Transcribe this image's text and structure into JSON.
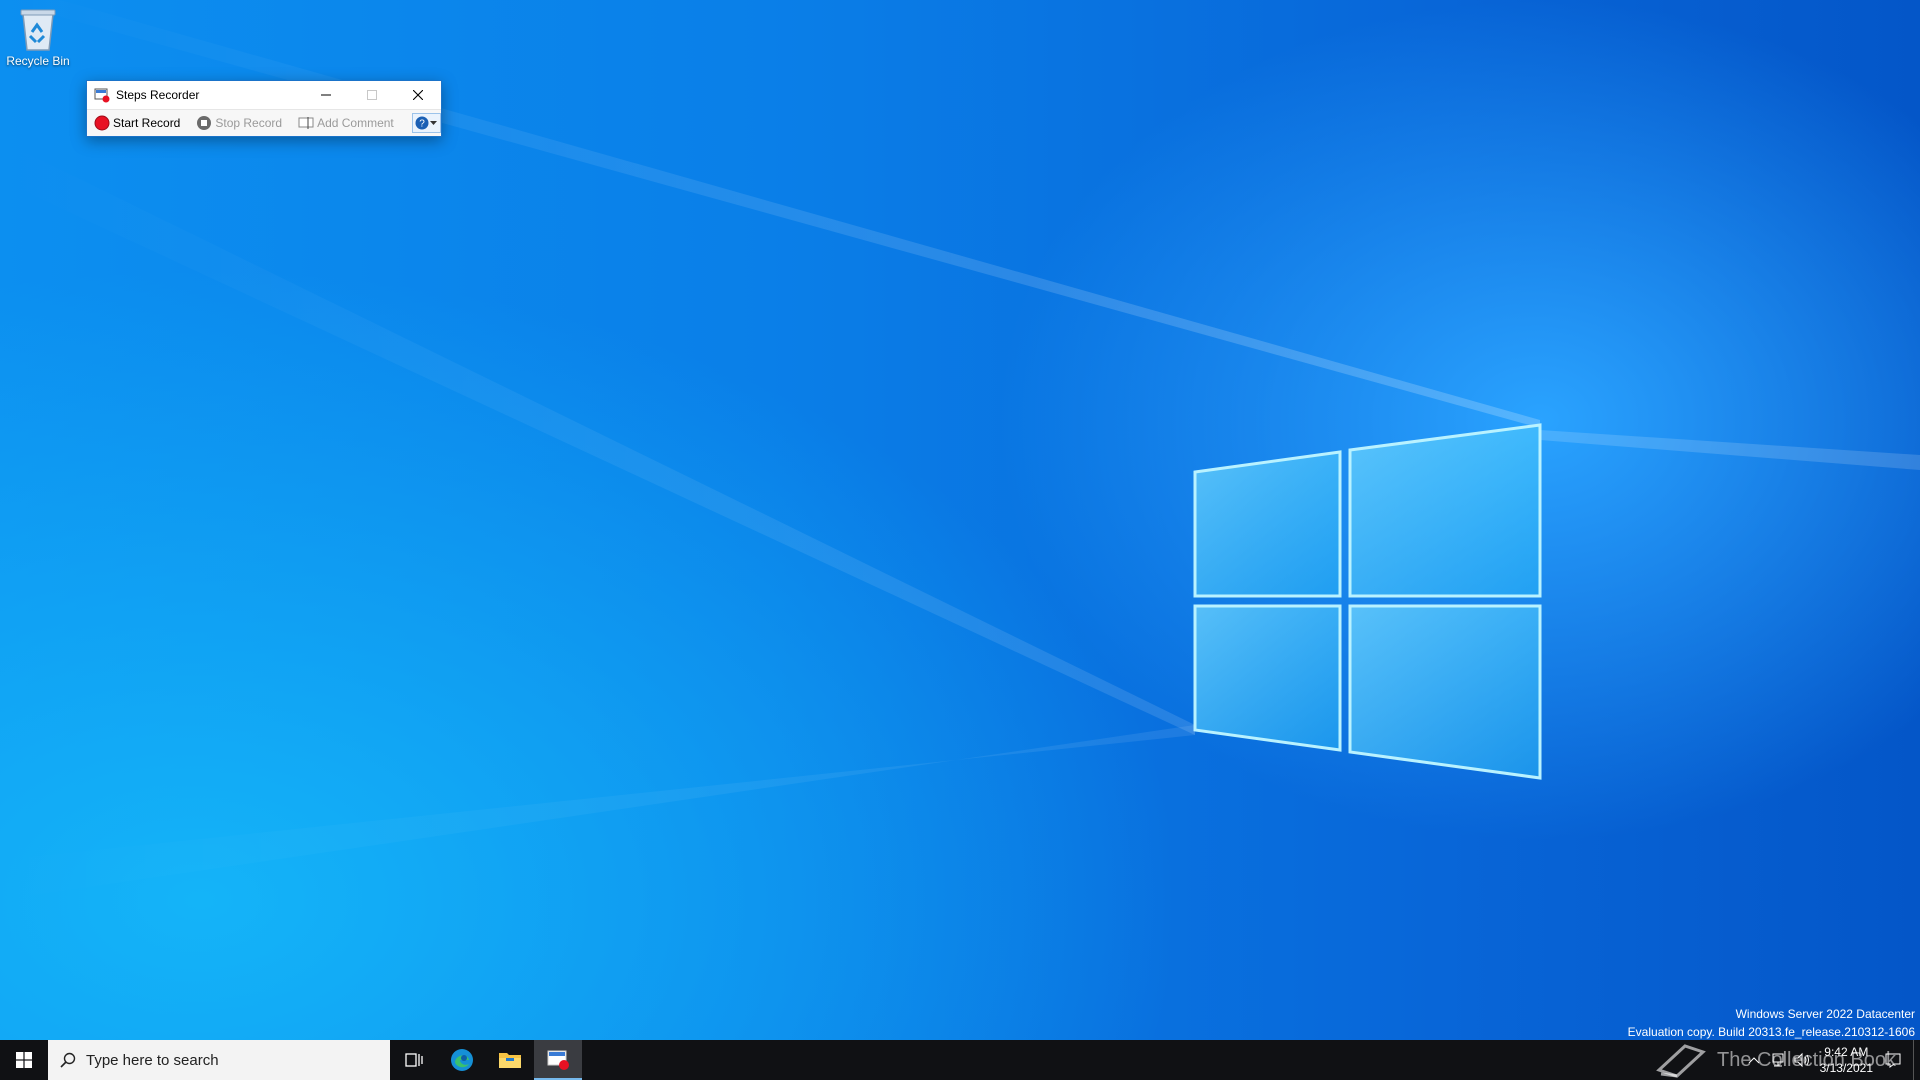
{
  "desktop": {
    "icons": [
      {
        "label": "Recycle Bin",
        "icon": "recycle-bin-icon"
      }
    ]
  },
  "window": {
    "title": "Steps Recorder",
    "controls": {
      "minimize": "minimize-icon",
      "maximize": "maximize-icon",
      "close": "close-icon"
    },
    "toolbar": {
      "start_record": "Start Record",
      "stop_record": "Stop Record",
      "add_comment": "Add Comment",
      "help": "help-icon"
    }
  },
  "watermark": {
    "line1": "Windows Server 2022 Datacenter",
    "line2": "Evaluation copy. Build 20313.fe_release.210312-1606"
  },
  "overlay": {
    "collection": "The Collection Book"
  },
  "taskbar": {
    "search_placeholder": "Type here to search",
    "clock": {
      "time": "9:42 AM",
      "date": "3/13/2021"
    }
  },
  "colors": {
    "accent": "#0078d7",
    "taskbar": "#101114",
    "record_red": "#e81123"
  }
}
